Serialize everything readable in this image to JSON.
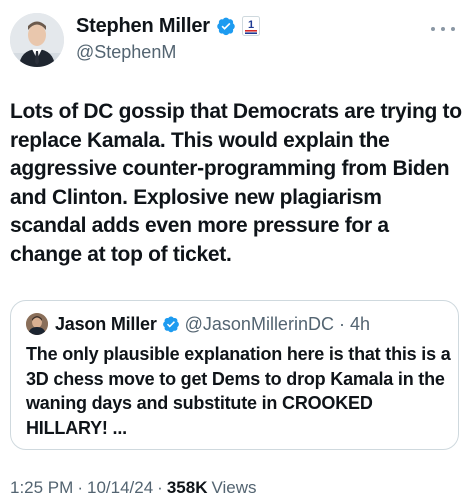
{
  "colors": {
    "text": "#0f1419",
    "secondary_text": "#536471",
    "verified_badge": "#1d9bf0",
    "border": "#cfd9de"
  },
  "author": {
    "display_name": "Stephen Miller",
    "handle": "@StephenM",
    "verified_icon": "verified-badge-icon",
    "affiliation_icon": "us-flag-affiliation-badge",
    "avatar": "profile-photo"
  },
  "tweet": {
    "text": "Lots of DC gossip that Democrats are trying to replace Kamala. This would explain the aggressive counter-programming from Biden and Clinton. Explosive new plagiarism scandal adds even more pressure for a change at top of ticket."
  },
  "quoted_tweet": {
    "display_name": "Jason Miller",
    "handle": "@JasonMillerinDC",
    "separator": "·",
    "time": "4h",
    "text": "The only plausible explanation here is that this is a 3D chess move to get Dems to drop Kamala in the waning days and substitute in CROOKED HILLARY! ..."
  },
  "meta": {
    "time": "1:25 PM",
    "separator": "·",
    "date": "10/14/24",
    "views_count": "358K",
    "views_label": "Views"
  }
}
